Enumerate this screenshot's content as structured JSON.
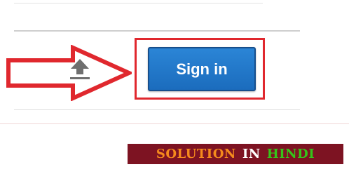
{
  "signin": {
    "label": "Sign in"
  },
  "banner": {
    "word1": "SOLUTION",
    "word2": "IN",
    "word3": "HINDI"
  },
  "icons": {
    "pointer": "arrow-right-icon",
    "upload": "upload-icon"
  },
  "colors": {
    "button_blue": "#1b6cbd",
    "highlight_red": "#e0282e",
    "banner_bg": "#7d1322",
    "banner_orange": "#f58a1d",
    "banner_white": "#ffffff",
    "banner_green": "#35c41a"
  }
}
